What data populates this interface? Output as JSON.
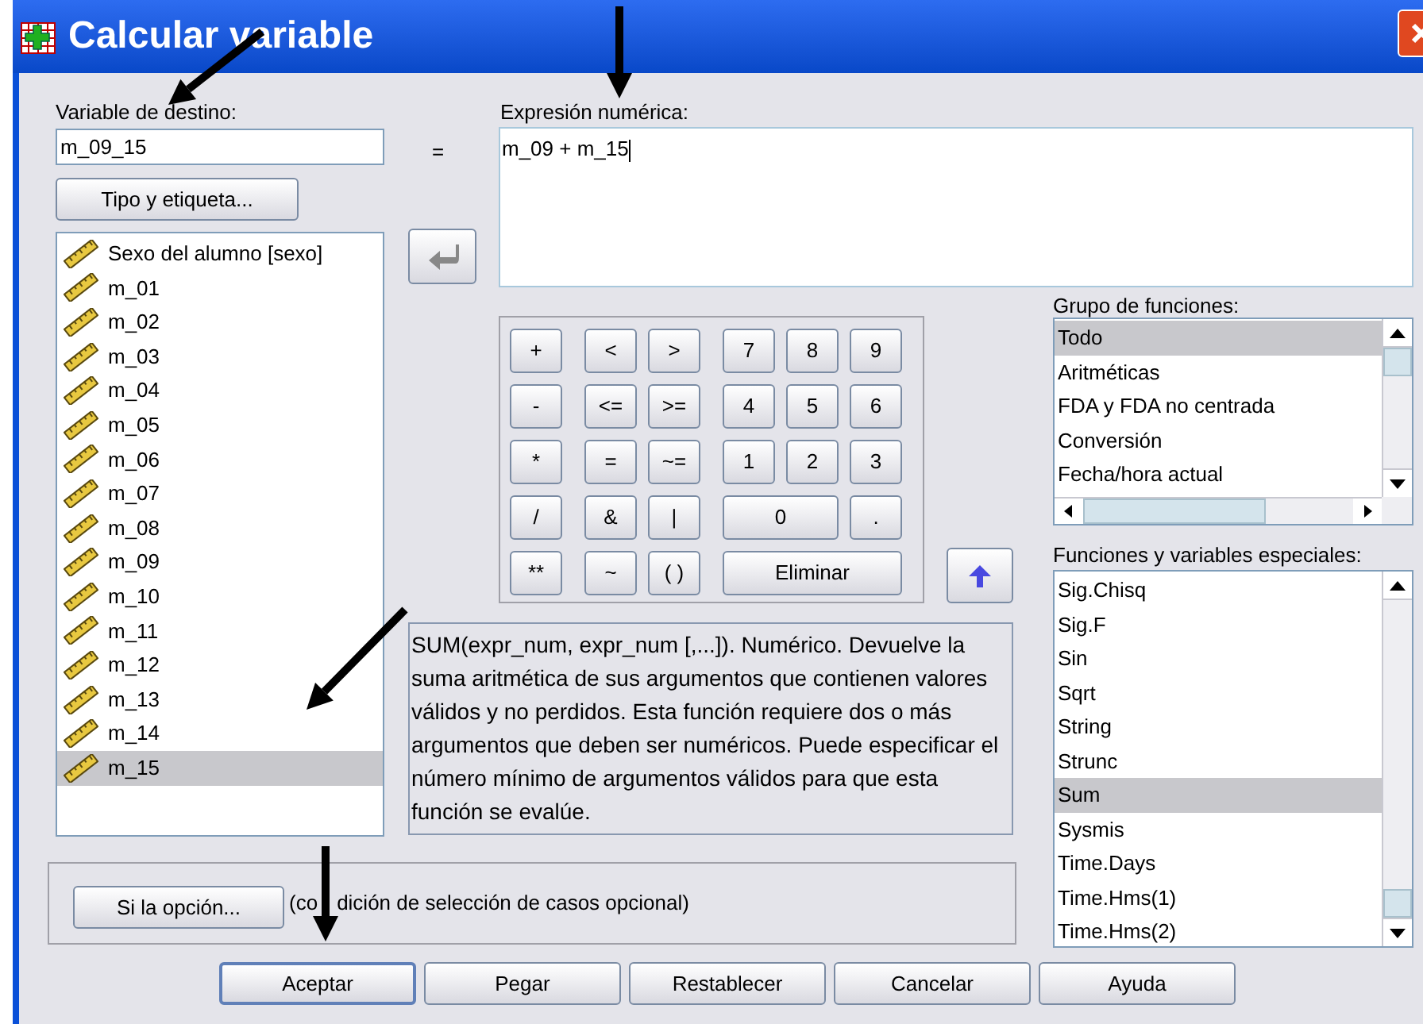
{
  "window": {
    "title": "Calcular variable"
  },
  "target": {
    "label": "Variable de destino:",
    "value": "m_09_15"
  },
  "equals": "=",
  "type_button": "Tipo y etiqueta...",
  "variables": [
    {
      "label": "Sexo del alumno [sexo]",
      "selected": false
    },
    {
      "label": "m_01",
      "selected": false
    },
    {
      "label": "m_02",
      "selected": false
    },
    {
      "label": "m_03",
      "selected": false
    },
    {
      "label": "m_04",
      "selected": false
    },
    {
      "label": "m_05",
      "selected": false
    },
    {
      "label": "m_06",
      "selected": false
    },
    {
      "label": "m_07",
      "selected": false
    },
    {
      "label": "m_08",
      "selected": false
    },
    {
      "label": "m_09",
      "selected": false
    },
    {
      "label": "m_10",
      "selected": false
    },
    {
      "label": "m_11",
      "selected": false
    },
    {
      "label": "m_12",
      "selected": false
    },
    {
      "label": "m_13",
      "selected": false
    },
    {
      "label": "m_14",
      "selected": false
    },
    {
      "label": "m_15",
      "selected": true
    }
  ],
  "expression": {
    "label": "Expresión numérica:",
    "value": "m_09 + m_15"
  },
  "keypad": [
    [
      "+",
      "<",
      ">",
      "7",
      "8",
      "9"
    ],
    [
      "-",
      "<=",
      ">=",
      "4",
      "5",
      "6"
    ],
    [
      "*",
      "=",
      "~=",
      "1",
      "2",
      "3"
    ],
    [
      "/",
      "&",
      "|",
      "0",
      "."
    ],
    [
      "**",
      "~",
      "( )",
      "Eliminar"
    ]
  ],
  "description": "SUM(expr_num, expr_num [,...]). Numérico. Devuelve la suma aritmética de sus argumentos que contienen valores válidos y no perdidos. Esta función requiere dos o más argumentos que deben ser numéricos. Puede especificar el número mínimo de argumentos válidos para que esta función se evalúe.",
  "function_groups": {
    "label": "Grupo de funciones:",
    "items": [
      {
        "label": "Todo",
        "selected": true
      },
      {
        "label": "Aritméticas",
        "selected": false
      },
      {
        "label": "FDA y FDA no centrada",
        "selected": false
      },
      {
        "label": "Conversión",
        "selected": false
      },
      {
        "label": "Fecha/hora actual",
        "selected": false
      }
    ]
  },
  "functions": {
    "label": "Funciones y variables especiales:",
    "items": [
      {
        "label": "Sig.Chisq",
        "selected": false
      },
      {
        "label": "Sig.F",
        "selected": false
      },
      {
        "label": "Sin",
        "selected": false
      },
      {
        "label": "Sqrt",
        "selected": false
      },
      {
        "label": "String",
        "selected": false
      },
      {
        "label": "Strunc",
        "selected": false
      },
      {
        "label": "Sum",
        "selected": true
      },
      {
        "label": "Sysmis",
        "selected": false
      },
      {
        "label": "Time.Days",
        "selected": false
      },
      {
        "label": "Time.Hms(1)",
        "selected": false
      },
      {
        "label": "Time.Hms(2)",
        "selected": false
      }
    ]
  },
  "condition": {
    "button": "Si la opción...",
    "note": [
      "(co",
      "dición de selección de casos opcional)"
    ]
  },
  "buttons": [
    {
      "label": "Aceptar",
      "default": true
    },
    {
      "label": "Pegar",
      "default": false
    },
    {
      "label": "Restablecer",
      "default": false
    },
    {
      "label": "Cancelar",
      "default": false
    },
    {
      "label": "Ayuda",
      "default": false
    }
  ]
}
